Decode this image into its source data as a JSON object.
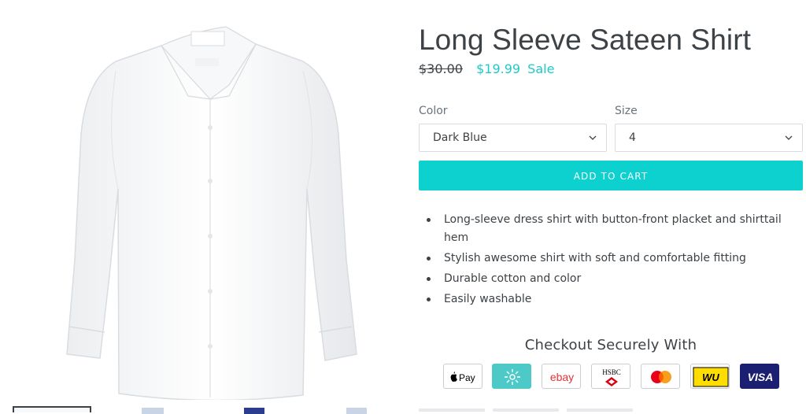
{
  "product": {
    "title": "Long Sleeve Sateen Shirt",
    "price_original": "$30.00",
    "price_sale": "$19.99",
    "sale_label": "Sale"
  },
  "image": {
    "icon": "white-dress-shirt-image",
    "tag_text": "Calvin Klein"
  },
  "options": {
    "color": {
      "label": "Color",
      "value": "Dark Blue"
    },
    "size": {
      "label": "Size",
      "value": "4"
    }
  },
  "cart": {
    "button_label": "ADD TO CART"
  },
  "features": [
    "Long-sleeve dress shirt with button-front placket and shirttail hem",
    "Stylish awesome shirt with soft and comfortable fitting",
    "Durable cotton and color",
    "Easily washable"
  ],
  "checkout": {
    "heading": "Checkout Securely With",
    "methods": [
      "Apple Pay",
      "Afterpay",
      "ebay",
      "HSBC",
      "Mastercard",
      "Western Union",
      "VISA"
    ],
    "apple_pay_label": "Pay",
    "ebay_label": "ebay",
    "hsbc_label": "HSBC",
    "wu_label": "WU",
    "visa_label": "VISA"
  },
  "colors": {
    "accent": "#0cd1cf",
    "text": "#3d4246",
    "muted": "#69727b",
    "border": "#d8dbdf"
  }
}
